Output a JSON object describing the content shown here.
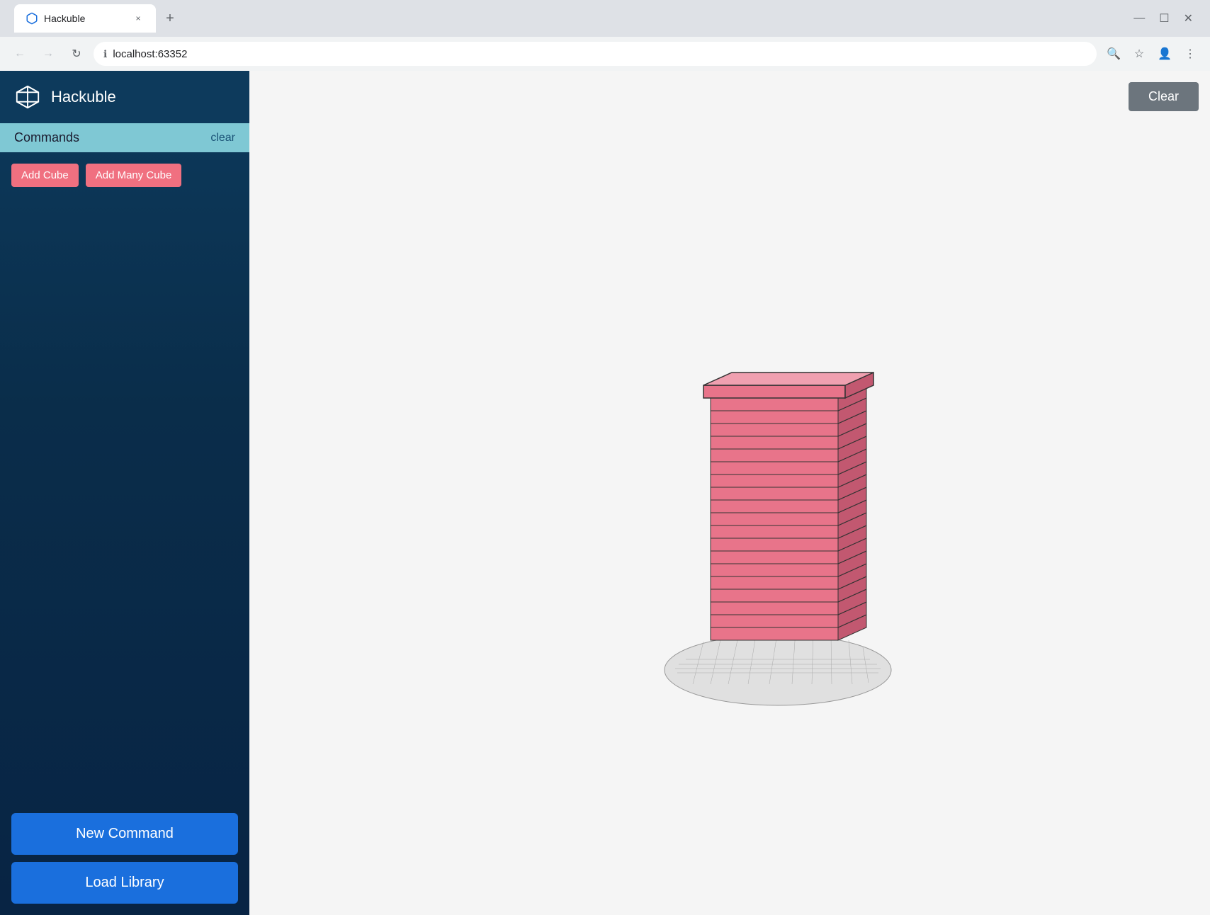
{
  "browser": {
    "tab": {
      "favicon": "cube",
      "title": "Hackuble",
      "close_label": "×"
    },
    "new_tab_label": "+",
    "window_controls": {
      "minimize": "—",
      "maximize": "☐",
      "close": "✕"
    },
    "address_bar": {
      "url": "localhost:63352",
      "info_icon": "ℹ"
    }
  },
  "sidebar": {
    "logo_alt": "Hackuble logo",
    "title": "Hackuble",
    "commands_section": {
      "label": "Commands",
      "clear_label": "clear"
    },
    "command_buttons": [
      {
        "label": "Add Cube",
        "id": "add-cube"
      },
      {
        "label": "Add Many Cube",
        "id": "add-many-cube"
      }
    ],
    "bottom_buttons": [
      {
        "label": "New Command",
        "id": "new-command"
      },
      {
        "label": "Load Library",
        "id": "load-library"
      }
    ]
  },
  "main": {
    "clear_button_label": "Clear"
  },
  "icons": {
    "search": "🔍",
    "star": "☆",
    "profile": "👤",
    "menu": "⋮",
    "dropdown": "▾",
    "back": "←",
    "forward": "→",
    "refresh": "↻"
  }
}
